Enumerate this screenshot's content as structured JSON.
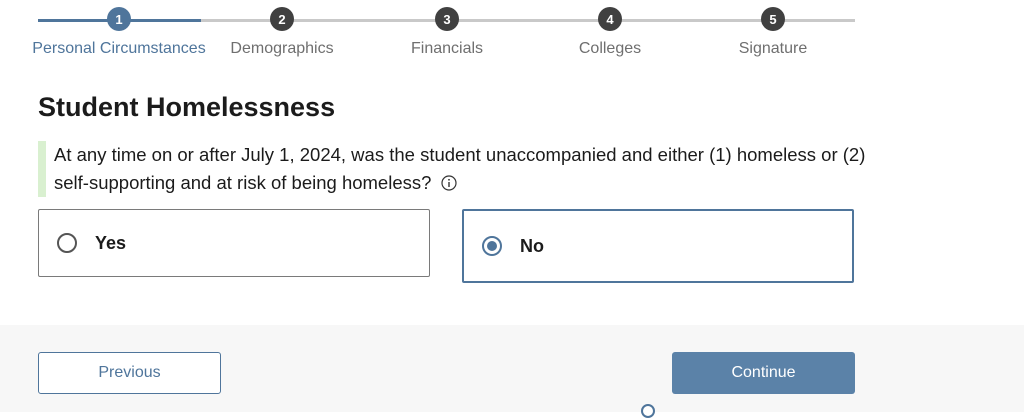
{
  "stepper": {
    "steps": [
      {
        "number": "1",
        "label": "Personal Circumstances",
        "state": "active"
      },
      {
        "number": "2",
        "label": "Demographics",
        "state": "upcoming"
      },
      {
        "number": "3",
        "label": "Financials",
        "state": "upcoming"
      },
      {
        "number": "4",
        "label": "Colleges",
        "state": "upcoming"
      },
      {
        "number": "5",
        "label": "Signature",
        "state": "upcoming"
      }
    ]
  },
  "page": {
    "title": "Student Homelessness",
    "question": "At any time on or after July 1, 2024, was the student unaccompanied and either (1) homeless or (2) self-supporting and at risk of being homeless?",
    "info_icon": "info-circle-icon"
  },
  "options": [
    {
      "label": "Yes",
      "selected": false
    },
    {
      "label": "No",
      "selected": true
    }
  ],
  "footer": {
    "previous_label": "Previous",
    "continue_label": "Continue"
  },
  "colors": {
    "accent": "#4f759b",
    "continue_bg": "#5b82a8",
    "question_rule": "#d9f0d0",
    "footer_bg": "#f7f7f7"
  }
}
